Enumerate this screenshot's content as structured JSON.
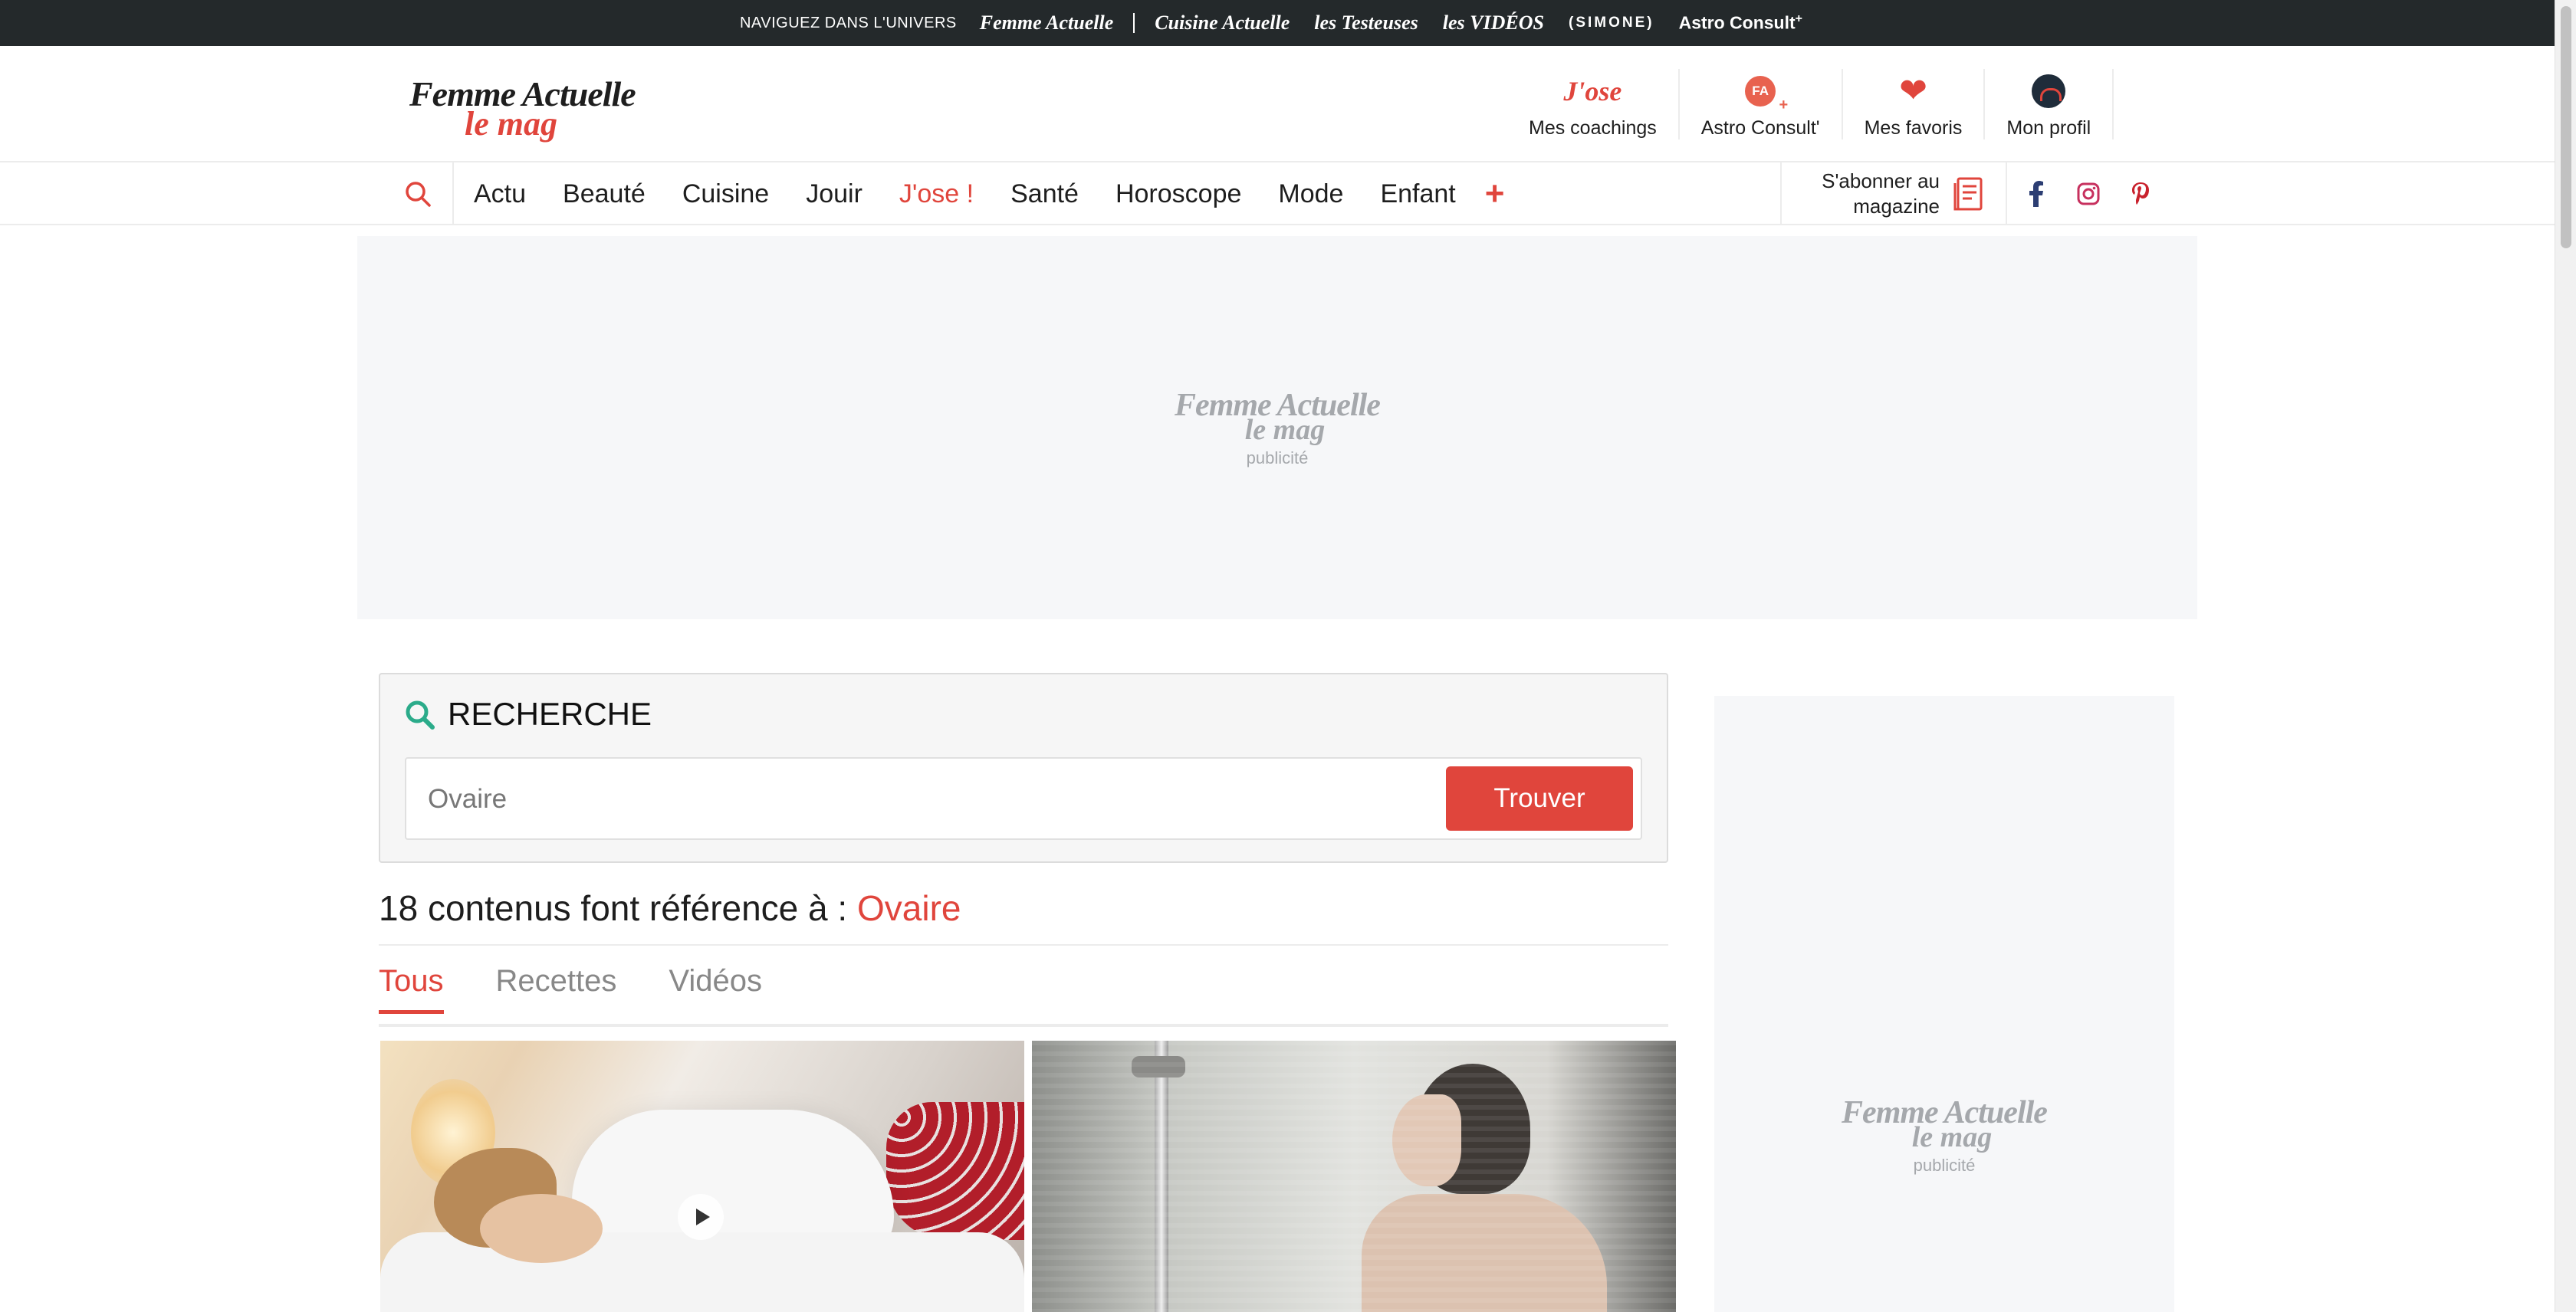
{
  "universe_bar": {
    "lead": "NAVIGUEZ DANS L'UNIVERS",
    "brands": [
      "Femme Actuelle",
      "Cuisine Actuelle",
      "les Testeuses",
      "les VIDÉOS",
      "(SIMONE)",
      "Astro Consult"
    ],
    "astro_sup": "+"
  },
  "header": {
    "logo_line1": "Femme Actuelle",
    "logo_line2": "le mag",
    "jose_logo": "J'ose",
    "fa_badge": "FA",
    "actions": [
      {
        "label": "Mes coachings",
        "icon": "jose-icon"
      },
      {
        "label": "Astro Consult'",
        "icon": "astro-consult-icon"
      },
      {
        "label": "Mes favoris",
        "icon": "heart-icon"
      },
      {
        "label": "Mon profil",
        "icon": "avatar-icon"
      }
    ]
  },
  "nav": {
    "items": [
      "Actu",
      "Beauté",
      "Cuisine",
      "Jouir",
      "J'ose !",
      "Santé",
      "Horoscope",
      "Mode",
      "Enfant"
    ],
    "accent_item": "J'ose !",
    "more": "+",
    "subscribe_line1": "S'abonner au",
    "subscribe_line2": "magazine",
    "socials": [
      "facebook-icon",
      "instagram-icon",
      "pinterest-icon"
    ]
  },
  "ads": {
    "logo_line1": "Femme Actuelle",
    "logo_line2": "le mag",
    "label": "publicité"
  },
  "search": {
    "title": "RECHERCHE",
    "value": "Ovaire",
    "placeholder": "Ovaire",
    "button": "Trouver"
  },
  "results": {
    "count": "18",
    "text": " contenus font référence à : ",
    "term": "Ovaire"
  },
  "tabs": [
    {
      "label": "Tous",
      "active": true
    },
    {
      "label": "Recettes",
      "active": false
    },
    {
      "label": "Vidéos",
      "active": false
    }
  ],
  "colors": {
    "accent": "#e0453c",
    "topbar": "#24292b",
    "search_icon": "#2bab8a"
  }
}
